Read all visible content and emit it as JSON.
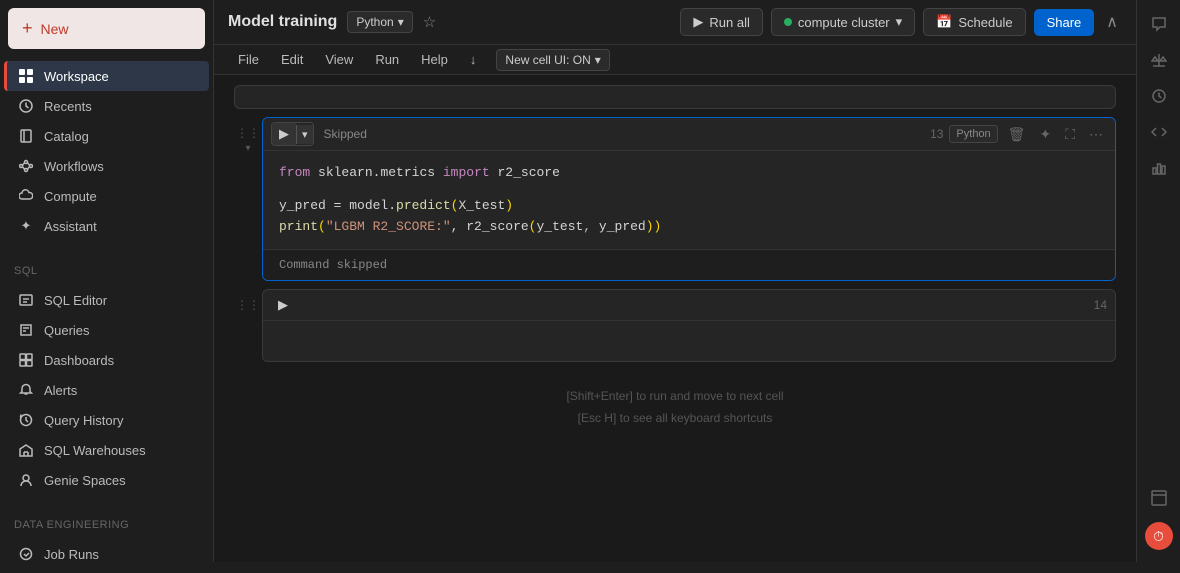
{
  "sidebar": {
    "new_button": "New",
    "items": [
      {
        "id": "workspace",
        "label": "Workspace",
        "icon": "grid"
      },
      {
        "id": "recents",
        "label": "Recents",
        "icon": "clock"
      },
      {
        "id": "catalog",
        "label": "Catalog",
        "icon": "book"
      },
      {
        "id": "workflows",
        "label": "Workflows",
        "icon": "flow"
      },
      {
        "id": "compute",
        "label": "Compute",
        "icon": "cloud"
      },
      {
        "id": "assistant",
        "label": "Assistant",
        "icon": "sparkle"
      }
    ],
    "sql_section": "SQL",
    "sql_items": [
      {
        "id": "sql-editor",
        "label": "SQL Editor",
        "icon": "sql"
      },
      {
        "id": "queries",
        "label": "Queries",
        "icon": "query"
      },
      {
        "id": "dashboards",
        "label": "Dashboards",
        "icon": "dashboard"
      },
      {
        "id": "alerts",
        "label": "Alerts",
        "icon": "bell"
      },
      {
        "id": "query-history",
        "label": "Query History",
        "icon": "history"
      },
      {
        "id": "sql-warehouses",
        "label": "SQL Warehouses",
        "icon": "warehouse"
      },
      {
        "id": "genie-spaces",
        "label": "Genie Spaces",
        "icon": "genie"
      }
    ],
    "data_eng_section": "Data Engineering",
    "data_eng_items": [
      {
        "id": "job-runs",
        "label": "Job Runs",
        "icon": "jobs"
      }
    ]
  },
  "topbar": {
    "title": "Model training",
    "language": "Python",
    "run_all": "Run all",
    "compute": "compute cluster",
    "schedule": "Schedule",
    "share": "Share",
    "new_cell_ui": "New cell UI: ON"
  },
  "menu": {
    "items": [
      "File",
      "Edit",
      "View",
      "Run",
      "Help",
      "↓"
    ]
  },
  "cells": [
    {
      "id": 1,
      "number": "13",
      "status": "Skipped",
      "language": "Python",
      "lines": [
        {
          "type": "code",
          "parts": [
            {
              "cls": "py-from",
              "text": "from"
            },
            {
              "cls": "py-normal",
              "text": " sklearn.metrics "
            },
            {
              "cls": "py-import",
              "text": "import"
            },
            {
              "cls": "py-normal",
              "text": " r2_score"
            }
          ]
        },
        {
          "type": "blank"
        },
        {
          "type": "code",
          "parts": [
            {
              "cls": "py-normal",
              "text": "y_pred = model."
            },
            {
              "cls": "fn",
              "text": "predict"
            },
            {
              "cls": "py-paren",
              "text": "("
            },
            {
              "cls": "py-normal",
              "text": "X_test"
            },
            {
              "cls": "py-paren",
              "text": ")"
            }
          ]
        },
        {
          "type": "code",
          "parts": [
            {
              "cls": "fn",
              "text": "print"
            },
            {
              "cls": "py-paren",
              "text": "("
            },
            {
              "cls": "str",
              "text": "\"LGBM R2_SCORE:\""
            },
            {
              "cls": "py-normal",
              "text": ", r2_score"
            },
            {
              "cls": "py-paren",
              "text": "("
            },
            {
              "cls": "py-normal",
              "text": "y_test"
            },
            {
              "cls": "py-paren",
              "text": ","
            },
            {
              "cls": "py-normal",
              "text": " y_pred"
            },
            {
              "cls": "py-paren",
              "text": "))"
            }
          ]
        }
      ],
      "output": "Command skipped"
    },
    {
      "id": 2,
      "number": "14",
      "status": "",
      "language": "",
      "lines": []
    }
  ],
  "hints": {
    "line1": "[Shift+Enter] to run and move to next cell",
    "line2": "[Esc H] to see all keyboard shortcuts"
  },
  "right_icons": [
    "chat",
    "scale",
    "history",
    "code",
    "chart",
    "layout"
  ]
}
